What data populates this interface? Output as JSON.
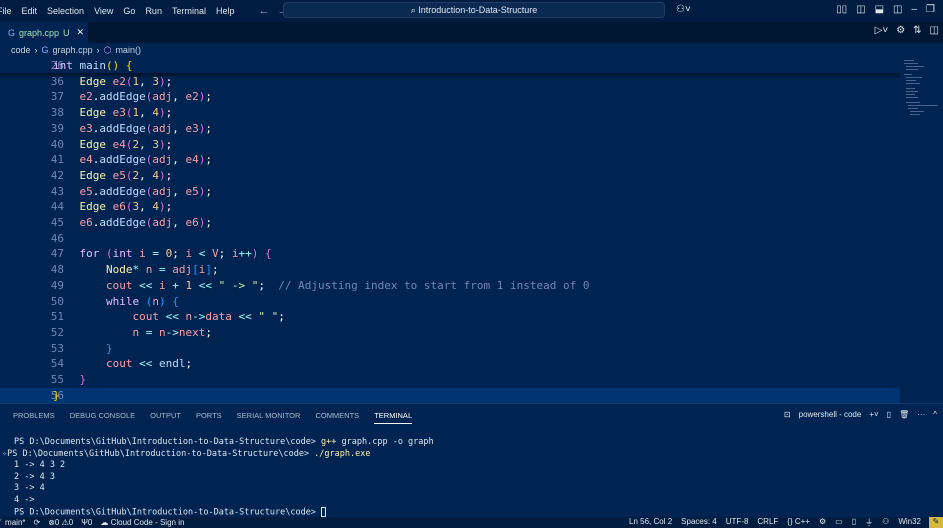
{
  "titlebar": {
    "menu": [
      "File",
      "Edit",
      "Selection",
      "View",
      "Go",
      "Run",
      "Terminal",
      "Help"
    ],
    "search": "Introduction-to-Data-Structure"
  },
  "tab": {
    "label": "graph.cpp",
    "status": "U"
  },
  "breadcrumb": [
    "code",
    "graph.cpp",
    "main()"
  ],
  "colors": {
    "background": "#002451",
    "current_line": "#003573",
    "statusbar": "#001c40"
  },
  "editor": {
    "sticky": {
      "num": "26",
      "tokens": [
        [
          "int",
          "kw"
        ],
        [
          " main",
          "fn"
        ],
        [
          "()",
          "b1"
        ],
        [
          " ",
          "pl"
        ],
        [
          "{",
          "b1"
        ]
      ]
    },
    "lines": [
      {
        "num": "36",
        "tokens": [
          [
            "    ",
            "pl"
          ],
          [
            "Edge",
            "tyy"
          ],
          [
            " e2",
            "var"
          ],
          [
            "(",
            "b2"
          ],
          [
            "1",
            "num"
          ],
          [
            ", ",
            "pl"
          ],
          [
            "3",
            "num"
          ],
          [
            ")",
            "b2"
          ],
          [
            ";",
            "pl"
          ]
        ]
      },
      {
        "num": "37",
        "tokens": [
          [
            "    ",
            "pl"
          ],
          [
            "e2",
            "var"
          ],
          [
            ".",
            "pl"
          ],
          [
            "addEdge",
            "fn"
          ],
          [
            "(",
            "b2"
          ],
          [
            "adj",
            "var"
          ],
          [
            ", ",
            "pl"
          ],
          [
            "e2",
            "var"
          ],
          [
            ")",
            "b2"
          ],
          [
            ";",
            "pl"
          ]
        ]
      },
      {
        "num": "38",
        "tokens": [
          [
            "    ",
            "pl"
          ],
          [
            "Edge",
            "tyy"
          ],
          [
            " e3",
            "var"
          ],
          [
            "(",
            "b2"
          ],
          [
            "1",
            "num"
          ],
          [
            ", ",
            "pl"
          ],
          [
            "4",
            "num"
          ],
          [
            ")",
            "b2"
          ],
          [
            ";",
            "pl"
          ]
        ]
      },
      {
        "num": "39",
        "tokens": [
          [
            "    ",
            "pl"
          ],
          [
            "e3",
            "var"
          ],
          [
            ".",
            "pl"
          ],
          [
            "addEdge",
            "fn"
          ],
          [
            "(",
            "b2"
          ],
          [
            "adj",
            "var"
          ],
          [
            ", ",
            "pl"
          ],
          [
            "e3",
            "var"
          ],
          [
            ")",
            "b2"
          ],
          [
            ";",
            "pl"
          ]
        ]
      },
      {
        "num": "40",
        "tokens": [
          [
            "    ",
            "pl"
          ],
          [
            "Edge",
            "tyy"
          ],
          [
            " e4",
            "var"
          ],
          [
            "(",
            "b2"
          ],
          [
            "2",
            "num"
          ],
          [
            ", ",
            "pl"
          ],
          [
            "3",
            "num"
          ],
          [
            ")",
            "b2"
          ],
          [
            ";",
            "pl"
          ]
        ]
      },
      {
        "num": "41",
        "tokens": [
          [
            "    ",
            "pl"
          ],
          [
            "e4",
            "var"
          ],
          [
            ".",
            "pl"
          ],
          [
            "addEdge",
            "fn"
          ],
          [
            "(",
            "b2"
          ],
          [
            "adj",
            "var"
          ],
          [
            ", ",
            "pl"
          ],
          [
            "e4",
            "var"
          ],
          [
            ")",
            "b2"
          ],
          [
            ";",
            "pl"
          ]
        ]
      },
      {
        "num": "42",
        "tokens": [
          [
            "    ",
            "pl"
          ],
          [
            "Edge",
            "tyy"
          ],
          [
            " e5",
            "var"
          ],
          [
            "(",
            "b2"
          ],
          [
            "2",
            "num"
          ],
          [
            ", ",
            "pl"
          ],
          [
            "4",
            "num"
          ],
          [
            ")",
            "b2"
          ],
          [
            ";",
            "pl"
          ]
        ]
      },
      {
        "num": "43",
        "tokens": [
          [
            "    ",
            "pl"
          ],
          [
            "e5",
            "var"
          ],
          [
            ".",
            "pl"
          ],
          [
            "addEdge",
            "fn"
          ],
          [
            "(",
            "b2"
          ],
          [
            "adj",
            "var"
          ],
          [
            ", ",
            "pl"
          ],
          [
            "e5",
            "var"
          ],
          [
            ")",
            "b2"
          ],
          [
            ";",
            "pl"
          ]
        ]
      },
      {
        "num": "44",
        "tokens": [
          [
            "    ",
            "pl"
          ],
          [
            "Edge",
            "tyy"
          ],
          [
            " e6",
            "var"
          ],
          [
            "(",
            "b2"
          ],
          [
            "3",
            "num"
          ],
          [
            ", ",
            "pl"
          ],
          [
            "4",
            "num"
          ],
          [
            ")",
            "b2"
          ],
          [
            ";",
            "pl"
          ]
        ]
      },
      {
        "num": "45",
        "tokens": [
          [
            "    ",
            "pl"
          ],
          [
            "e6",
            "var"
          ],
          [
            ".",
            "pl"
          ],
          [
            "addEdge",
            "fn"
          ],
          [
            "(",
            "b2"
          ],
          [
            "adj",
            "var"
          ],
          [
            ", ",
            "pl"
          ],
          [
            "e6",
            "var"
          ],
          [
            ")",
            "b2"
          ],
          [
            ";",
            "pl"
          ]
        ]
      },
      {
        "num": "46",
        "tokens": []
      },
      {
        "num": "47",
        "tokens": [
          [
            "    ",
            "pl"
          ],
          [
            "for",
            "kw"
          ],
          [
            " ",
            "pl"
          ],
          [
            "(",
            "b2"
          ],
          [
            "int",
            "kw"
          ],
          [
            " i",
            "var"
          ],
          [
            " = ",
            "op"
          ],
          [
            "0",
            "num"
          ],
          [
            "; ",
            "pl"
          ],
          [
            "i",
            "var"
          ],
          [
            " < ",
            "op"
          ],
          [
            "V",
            "var"
          ],
          [
            "; ",
            "pl"
          ],
          [
            "i",
            "var"
          ],
          [
            "++",
            "op"
          ],
          [
            ")",
            "b2"
          ],
          [
            " ",
            "pl"
          ],
          [
            "{",
            "b2"
          ]
        ]
      },
      {
        "num": "48",
        "tokens": [
          [
            "        ",
            "pl"
          ],
          [
            "Node",
            "tyy"
          ],
          [
            "*",
            "op"
          ],
          [
            " n",
            "var"
          ],
          [
            " = ",
            "op"
          ],
          [
            "adj",
            "var"
          ],
          [
            "[",
            "b3"
          ],
          [
            "i",
            "var"
          ],
          [
            "]",
            "b3"
          ],
          [
            ";",
            "pl"
          ]
        ]
      },
      {
        "num": "49",
        "tokens": [
          [
            "        ",
            "pl"
          ],
          [
            "cout",
            "var"
          ],
          [
            " << ",
            "op"
          ],
          [
            "i",
            "var"
          ],
          [
            " + ",
            "op"
          ],
          [
            "1",
            "num"
          ],
          [
            " << ",
            "op"
          ],
          [
            "\" -> \"",
            "str"
          ],
          [
            ";  ",
            "pl"
          ],
          [
            "// Adjusting index to start from 1 instead of 0",
            "com"
          ]
        ]
      },
      {
        "num": "50",
        "tokens": [
          [
            "        ",
            "pl"
          ],
          [
            "while",
            "kw"
          ],
          [
            " ",
            "pl"
          ],
          [
            "(",
            "b3"
          ],
          [
            "n",
            "var"
          ],
          [
            ")",
            "b3"
          ],
          [
            " ",
            "pl"
          ],
          [
            "{",
            "b3"
          ]
        ]
      },
      {
        "num": "51",
        "tokens": [
          [
            "            ",
            "pl"
          ],
          [
            "cout",
            "var"
          ],
          [
            " << ",
            "op"
          ],
          [
            "n",
            "var"
          ],
          [
            "->",
            "op"
          ],
          [
            "data",
            "var"
          ],
          [
            " << ",
            "op"
          ],
          [
            "\" \"",
            "str"
          ],
          [
            ";",
            "pl"
          ]
        ]
      },
      {
        "num": "52",
        "tokens": [
          [
            "            ",
            "pl"
          ],
          [
            "n",
            "var"
          ],
          [
            " = ",
            "op"
          ],
          [
            "n",
            "var"
          ],
          [
            "->",
            "op"
          ],
          [
            "next",
            "var"
          ],
          [
            ";",
            "pl"
          ]
        ]
      },
      {
        "num": "53",
        "tokens": [
          [
            "        ",
            "pl"
          ],
          [
            "}",
            "b3"
          ]
        ]
      },
      {
        "num": "54",
        "tokens": [
          [
            "        ",
            "pl"
          ],
          [
            "cout",
            "var"
          ],
          [
            " << ",
            "op"
          ],
          [
            "endl",
            "fn"
          ],
          [
            ";",
            "pl"
          ]
        ]
      },
      {
        "num": "55",
        "tokens": [
          [
            "    ",
            "pl"
          ],
          [
            "}",
            "b2"
          ]
        ]
      },
      {
        "num": "56",
        "tokens": [
          [
            "}",
            "b1"
          ]
        ],
        "current": true
      }
    ]
  },
  "panel": {
    "tabs": [
      "PROBLEMS",
      "DEBUG CONSOLE",
      "OUTPUT",
      "PORTS",
      "SERIAL MONITOR",
      "COMMENTS",
      "TERMINAL"
    ],
    "active": "TERMINAL",
    "terminal_name": "powershell - code"
  },
  "terminal": {
    "prompt": "PS D:\\Documents\\GitHub\\Introduction-to-Data-Structure\\code> ",
    "cmd1_exe": "g++",
    "cmd1_args": " graph.cpp -o graph",
    "cmd2": "./graph.exe",
    "output": [
      "1 -> 4 3 2",
      "2 -> 4 3",
      "3 -> 4",
      "4 ->"
    ]
  },
  "statusbar": {
    "branch": "main*",
    "errors": "0",
    "warnings": "0",
    "ports": "0",
    "cloud": "Cloud Code - Sign in",
    "position": "Ln 56, Col 2",
    "spaces": "Spaces: 4",
    "encoding": "UTF-8",
    "eol": "CRLF",
    "language": "C++",
    "platform": "Win32"
  }
}
